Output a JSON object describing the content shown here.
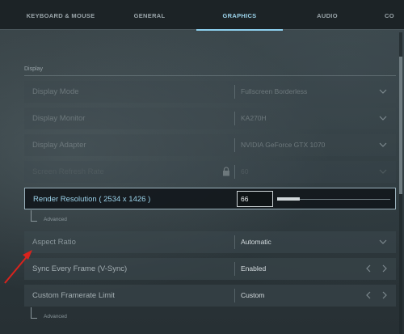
{
  "tabs": [
    {
      "label": "KEYBOARD & MOUSE"
    },
    {
      "label": "GENERAL"
    },
    {
      "label": "GRAPHICS"
    },
    {
      "label": "AUDIO"
    },
    {
      "label": "CO"
    }
  ],
  "section": {
    "title": "Display"
  },
  "rows": {
    "display_mode": {
      "label": "Display Mode",
      "value": "Fullscreen Borderless"
    },
    "display_monitor": {
      "label": "Display Monitor",
      "value": "KA270H"
    },
    "display_adapter": {
      "label": "Display Adapter",
      "value": "NVIDIA GeForce GTX 1070"
    },
    "refresh_rate": {
      "label": "Screen Refresh Rate",
      "value": "60"
    },
    "render_resolution": {
      "label": "Render Resolution ( 2534 x 1426 )",
      "value": "66",
      "slider_fraction": 0.2
    },
    "render_advanced": {
      "label": "Advanced"
    },
    "aspect_ratio": {
      "label": "Aspect Ratio",
      "value": "Automatic"
    },
    "vsync": {
      "label": "Sync Every Frame (V-Sync)",
      "value": "Enabled"
    },
    "framerate_limit": {
      "label": "Custom Framerate Limit",
      "value": "Custom"
    },
    "framerate_advanced": {
      "label": "Advanced"
    }
  },
  "colors": {
    "accent": "#9bd3ea",
    "annotation": "#d9231d"
  }
}
